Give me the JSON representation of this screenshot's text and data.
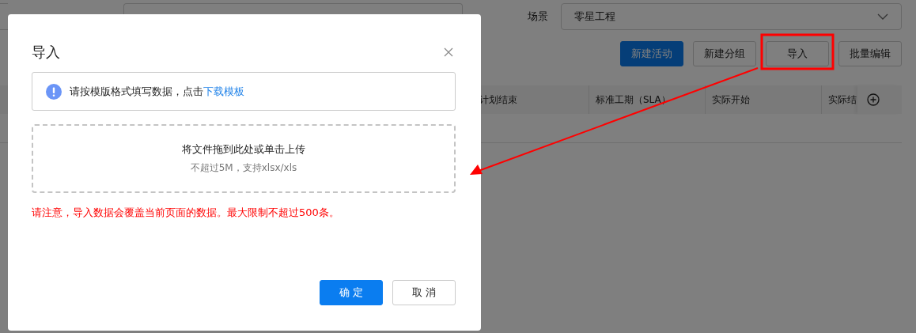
{
  "page": {
    "filters": [
      {
        "label": "场景",
        "value": "零星工程"
      }
    ],
    "toolbar": [
      {
        "label": "新建活动",
        "kind": "primary",
        "highlighted": false
      },
      {
        "label": "新建分组",
        "kind": "default",
        "highlighted": false
      },
      {
        "label": "导入",
        "kind": "default",
        "highlighted": true
      },
      {
        "label": "批量编辑",
        "kind": "default",
        "highlighted": false
      }
    ],
    "table": {
      "columns": [
        "计划结束",
        "标准工期（SLA）",
        "实际开始",
        "实际结"
      ]
    }
  },
  "dialog": {
    "title": "导入",
    "notice": {
      "text": "请按模版格式填写数据，点击",
      "link": "下载模板"
    },
    "upload": {
      "prompt": "将文件拖到此处或单击上传",
      "hint": "不超过5M，支持xlsx/xls"
    },
    "warning": "请注意，导入数据会覆盖当前页面的数据。最大限制不超过500条。",
    "buttons": [
      {
        "label": "确 定",
        "kind": "primary"
      },
      {
        "label": "取 消",
        "kind": "default"
      }
    ]
  }
}
